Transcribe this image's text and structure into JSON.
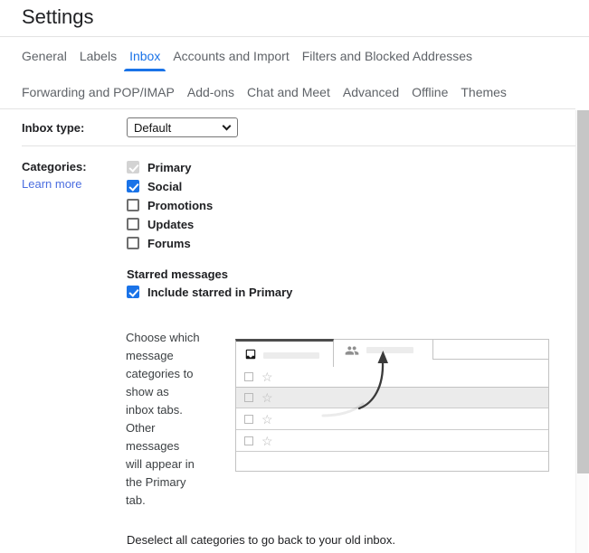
{
  "header": {
    "title": "Settings"
  },
  "tabs": {
    "row1": [
      {
        "label": "General",
        "active": false
      },
      {
        "label": "Labels",
        "active": false
      },
      {
        "label": "Inbox",
        "active": true
      },
      {
        "label": "Accounts and Import",
        "active": false
      },
      {
        "label": "Filters and Blocked Addresses",
        "active": false
      }
    ],
    "row2": [
      {
        "label": "Forwarding and POP/IMAP"
      },
      {
        "label": "Add-ons"
      },
      {
        "label": "Chat and Meet"
      },
      {
        "label": "Advanced"
      },
      {
        "label": "Offline"
      },
      {
        "label": "Themes"
      }
    ]
  },
  "inbox_type": {
    "label": "Inbox type:",
    "selected": "Default"
  },
  "categories": {
    "label": "Categories:",
    "learn_more": "Learn more",
    "items": [
      {
        "label": "Primary",
        "checked": true,
        "disabled": true
      },
      {
        "label": "Social",
        "checked": true,
        "disabled": false
      },
      {
        "label": "Promotions",
        "checked": false,
        "disabled": false
      },
      {
        "label": "Updates",
        "checked": false,
        "disabled": false
      },
      {
        "label": "Forums",
        "checked": false,
        "disabled": false
      }
    ]
  },
  "starred": {
    "heading": "Starred messages",
    "checkbox_label": "Include starred in Primary",
    "checked": true
  },
  "description": "Choose which\nmessage\ncategories to\nshow as\ninbox tabs.\nOther\nmessages\nwill appear in\nthe Primary\ntab.",
  "footer_note": "Deselect all categories to go back to your old inbox.",
  "illustration": {
    "tab1_icon": "inbox-icon",
    "tab2_icon": "people-icon",
    "star_glyph": "☆",
    "rows": 4,
    "highlighted_row": 2
  },
  "colors": {
    "accent_blue": "#1a73e8",
    "link_blue": "#4b6ee0",
    "tab_gray": "#5f6368",
    "text_dark": "#202124",
    "scrollbar_thumb": "#c6c6c6"
  }
}
